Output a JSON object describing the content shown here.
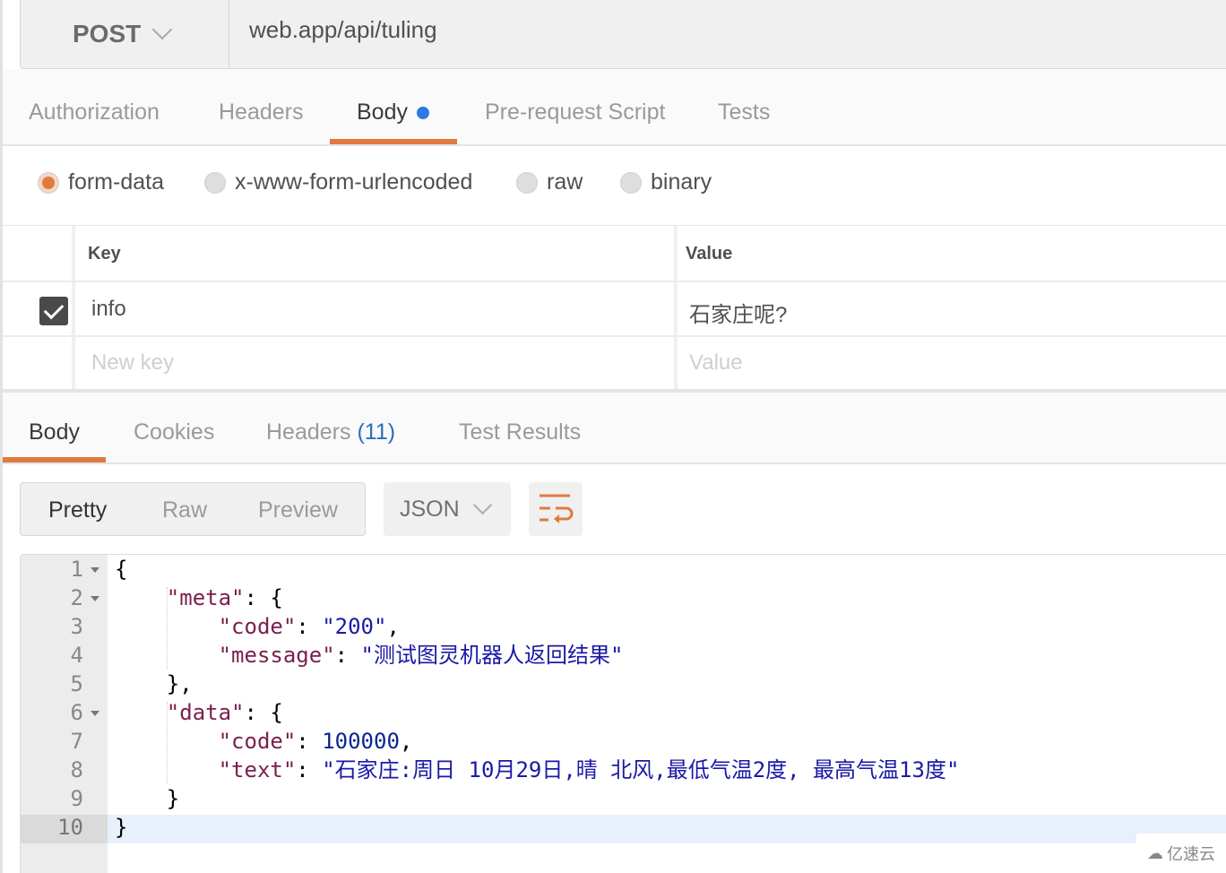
{
  "request": {
    "method": "POST",
    "url": "web.app/api/tuling",
    "tabs": [
      {
        "label": "Authorization"
      },
      {
        "label": "Headers"
      },
      {
        "label": "Body",
        "active": true,
        "modified": true
      },
      {
        "label": "Pre-request Script"
      },
      {
        "label": "Tests"
      }
    ],
    "body_modes": [
      {
        "label": "form-data",
        "selected": true
      },
      {
        "label": "x-www-form-urlencoded"
      },
      {
        "label": "raw"
      },
      {
        "label": "binary"
      }
    ],
    "table": {
      "headers": {
        "key": "Key",
        "value": "Value"
      },
      "rows": [
        {
          "checked": true,
          "key": "info",
          "value": "石家庄呢?"
        }
      ],
      "new_row": {
        "key_placeholder": "New key",
        "value_placeholder": "Value"
      }
    }
  },
  "response": {
    "tabs": [
      {
        "label": "Body",
        "active": true
      },
      {
        "label": "Cookies"
      },
      {
        "label": "Headers",
        "count": "(11)"
      },
      {
        "label": "Test Results"
      }
    ],
    "view_modes": [
      "Pretty",
      "Raw",
      "Preview"
    ],
    "active_view": "Pretty",
    "format": "JSON",
    "wrap_icon": "wrap-lines-icon",
    "code_lines": [
      [
        [
          "p",
          "{"
        ]
      ],
      [
        [
          "p",
          "    "
        ],
        [
          "k",
          "\"meta\""
        ],
        [
          "p",
          ": {"
        ]
      ],
      [
        [
          "p",
          "        "
        ],
        [
          "k",
          "\"code\""
        ],
        [
          "p",
          ": "
        ],
        [
          "s",
          "\"200\""
        ],
        [
          "p",
          ","
        ]
      ],
      [
        [
          "p",
          "        "
        ],
        [
          "k",
          "\"message\""
        ],
        [
          "p",
          ": "
        ],
        [
          "s",
          "\"测试图灵机器人返回结果\""
        ]
      ],
      [
        [
          "p",
          "    },"
        ]
      ],
      [
        [
          "p",
          "    "
        ],
        [
          "k",
          "\"data\""
        ],
        [
          "p",
          ": {"
        ]
      ],
      [
        [
          "p",
          "        "
        ],
        [
          "k",
          "\"code\""
        ],
        [
          "p",
          ": "
        ],
        [
          "n",
          "100000"
        ],
        [
          "p",
          ","
        ]
      ],
      [
        [
          "p",
          "        "
        ],
        [
          "k",
          "\"text\""
        ],
        [
          "p",
          ": "
        ],
        [
          "s",
          "\"石家庄:周日 10月29日,晴 北风,最低气温2度, 最高气温13度\""
        ]
      ],
      [
        [
          "p",
          "    }"
        ]
      ],
      [
        [
          "p",
          "}"
        ]
      ]
    ],
    "foldable_lines": [
      1,
      2,
      6
    ],
    "active_line": 10
  },
  "watermark": "亿速云",
  "colors": {
    "accent": "#e07a3f",
    "dot": "#2a7ae2",
    "key": "#7a1f4f",
    "string": "#1a1aa6"
  }
}
